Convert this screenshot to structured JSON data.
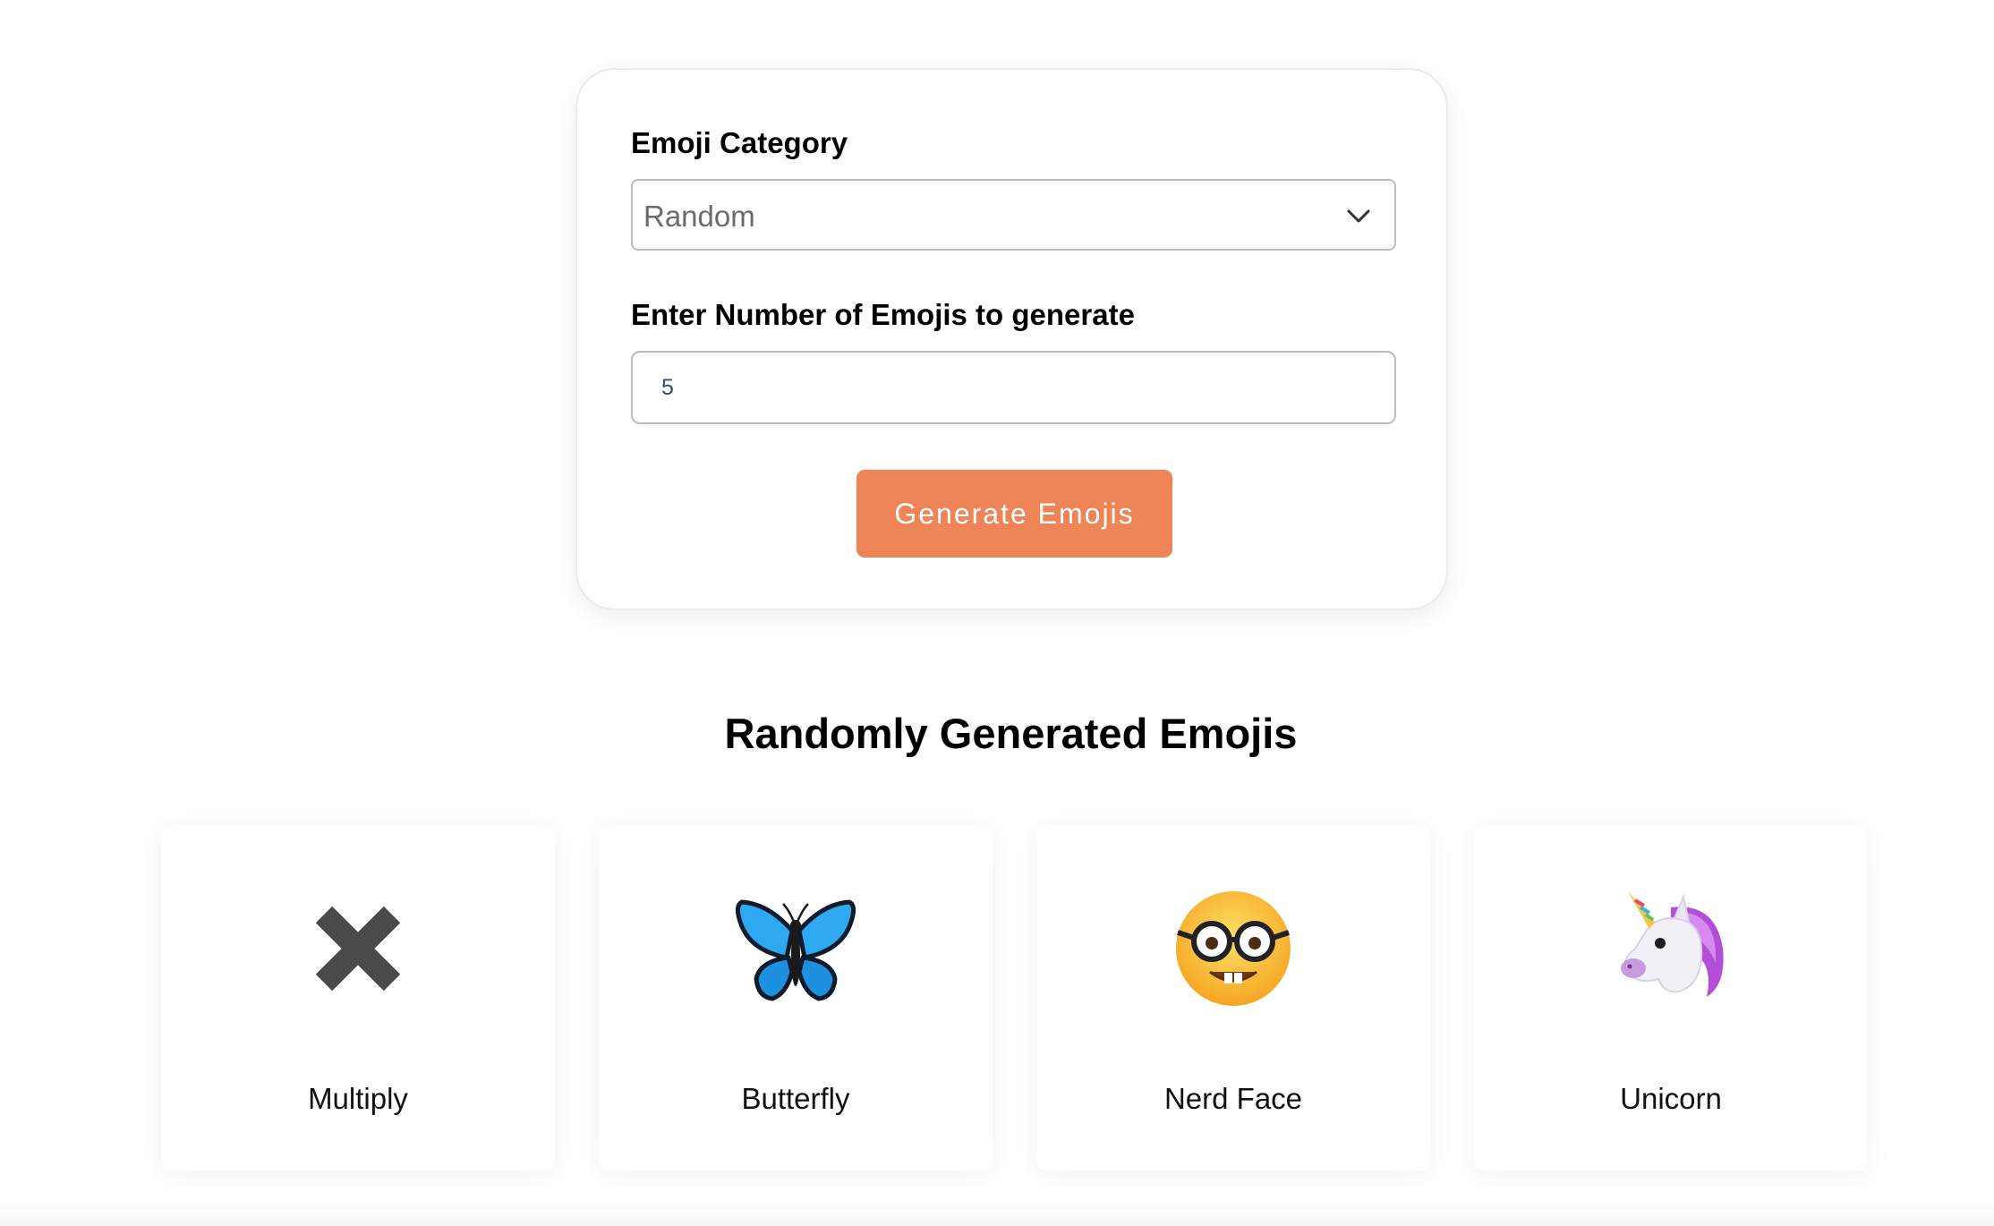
{
  "form": {
    "category_label": "Emoji Category",
    "category_value": "Random",
    "count_label": "Enter Number of Emojis to generate",
    "count_value": "5",
    "generate_label": "Generate Emojis",
    "accent_color": "#ef8457"
  },
  "results": {
    "heading": "Randomly Generated Emojis",
    "emojis": [
      {
        "name": "Multiply",
        "icon": "multiply-x-icon"
      },
      {
        "name": "Butterfly",
        "icon": "butterfly-icon"
      },
      {
        "name": "Nerd Face",
        "icon": "nerd-face-icon"
      },
      {
        "name": "Unicorn",
        "icon": "unicorn-icon"
      }
    ]
  }
}
